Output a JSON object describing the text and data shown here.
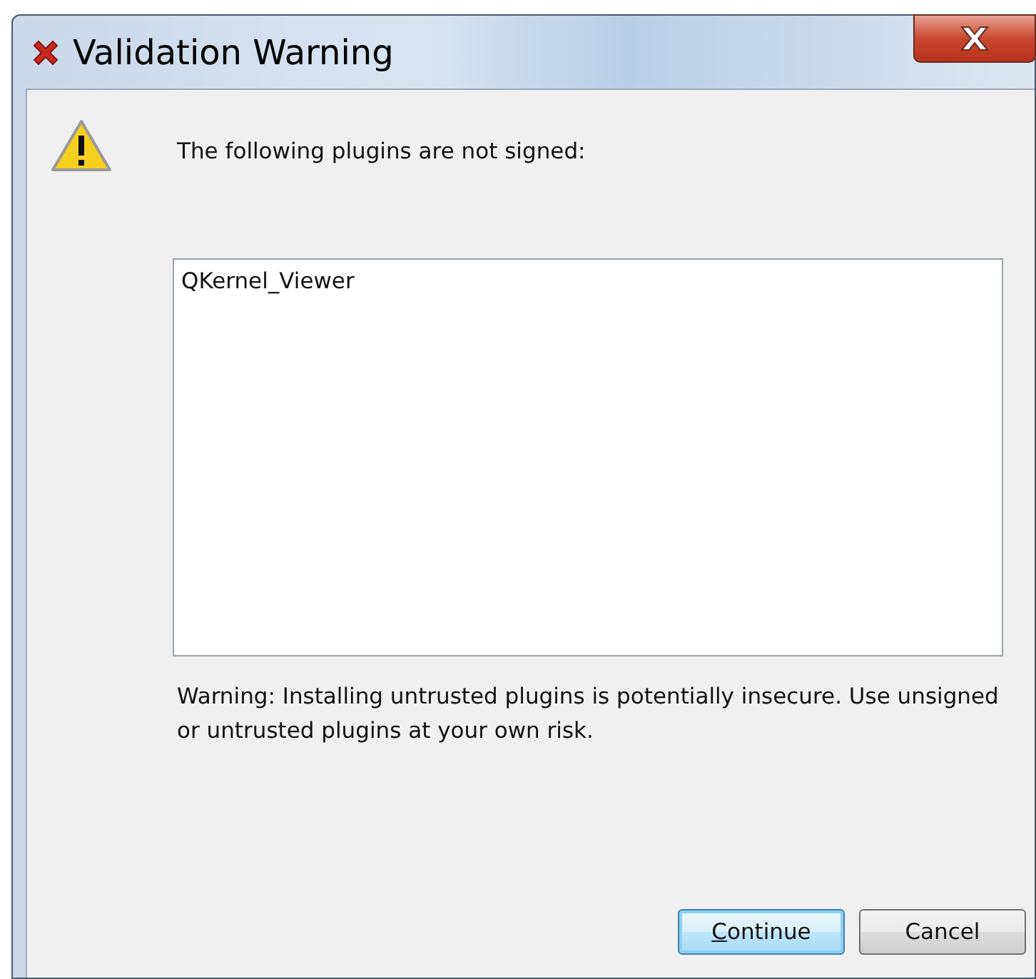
{
  "window": {
    "title": "Validation Warning"
  },
  "message": "The following plugins are not signed:",
  "plugins": [
    "QKernel_Viewer"
  ],
  "warning": "Warning: Installing untrusted plugins is potentially insecure. Use unsigned or untrusted plugins at your own risk.",
  "buttons": [
    {
      "label": "Continue",
      "default": true,
      "mnemonic_underlined": true
    },
    {
      "label": "Cancel",
      "default": false,
      "mnemonic_underlined": false
    }
  ]
}
